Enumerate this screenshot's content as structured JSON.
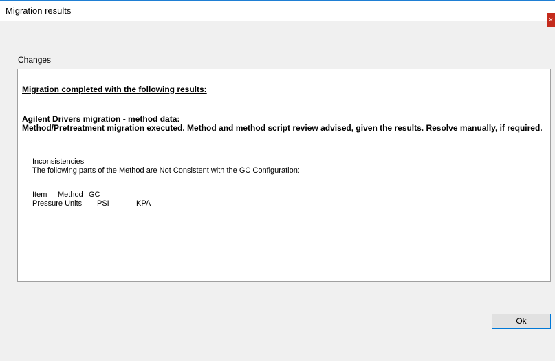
{
  "window": {
    "title": "Migration results",
    "close_glyph": "×"
  },
  "changes": {
    "group_label": "Changes",
    "heading": "Migration completed with the following results:",
    "section_title": "Agilent Drivers migration - method data:",
    "section_body": "Method/Pretreatment migration executed. Method and method script review advised, given the results. Resolve manually, if required.",
    "inconsistencies_label": "Inconsistencies",
    "inconsistencies_text": "The following parts of the Method are Not Consistent with the GC Configuration:",
    "table": {
      "headers": [
        "Item",
        "Method",
        "GC"
      ],
      "rows": [
        [
          "Pressure Units",
          "PSI",
          "KPA"
        ]
      ]
    }
  },
  "buttons": {
    "ok_label": "Ok"
  },
  "colors": {
    "accent": "#0078d7",
    "close": "#c42b1c"
  }
}
